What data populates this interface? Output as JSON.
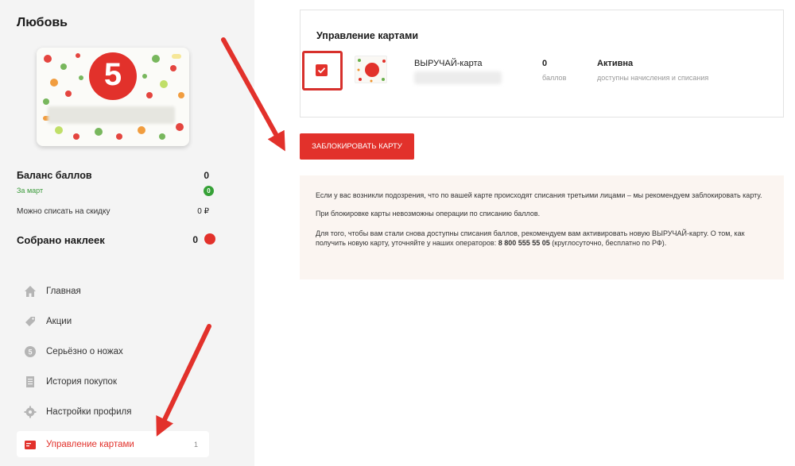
{
  "user": {
    "name": "Любовь"
  },
  "balance": {
    "title": "Баланс баллов",
    "value": "0",
    "period": "За март",
    "period_value": "0",
    "discount_label": "Можно списать на скидку",
    "discount_value": "0 ₽",
    "stickers_label": "Собрано наклеек",
    "stickers_value": "0"
  },
  "nav": {
    "items": [
      {
        "label": "Главная",
        "icon": "home-icon"
      },
      {
        "label": "Акции",
        "icon": "tag-icon"
      },
      {
        "label": "Серьёзно о ножах",
        "icon": "coin-icon"
      },
      {
        "label": "История покупок",
        "icon": "receipt-icon"
      },
      {
        "label": "Настройки профиля",
        "icon": "gear-icon"
      },
      {
        "label": "Управление картами",
        "icon": "card-icon",
        "badge": "1",
        "active": true
      }
    ]
  },
  "cards_panel": {
    "title": "Управление картами",
    "card_name": "ВЫРУЧАЙ-карта",
    "points_value": "0",
    "points_label": "баллов",
    "status_value": "Активна",
    "status_label": "доступны начисления и списания"
  },
  "block_button": {
    "label": "ЗАБЛОКИРОВАТЬ КАРТУ"
  },
  "info": {
    "p1": "Если у вас возникли подозрения, что по вашей карте происходят списания третьими лицами – мы рекомендуем заблокировать карту.",
    "p2": "При блокировке карты невозможны операции по списанию баллов.",
    "p3_before": "Для того, чтобы вам стали снова доступны списания баллов, рекомендуем вам активировать новую ВЫРУЧАЙ-карту. О том, как получить новую карту, уточняйте у наших операторов: ",
    "phone": "8 800 555 55 05",
    "p3_after": " (круглосуточно, бесплатно по РФ)."
  },
  "colors": {
    "brand_red": "#e2312b",
    "accent_green": "#36a137",
    "sidebar_bg": "#f4f4f4",
    "info_bg": "#fbf5f1"
  }
}
